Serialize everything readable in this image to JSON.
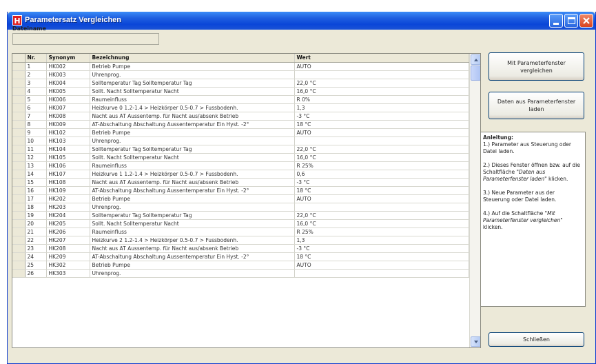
{
  "window": {
    "title": "Parametersatz Vergleichen",
    "icon_letter": "H"
  },
  "file": {
    "label": "Dateiname",
    "value": ""
  },
  "grid": {
    "columns": [
      "Nr.",
      "Synonym",
      "Bezeichnung",
      "Wert"
    ],
    "rows": [
      [
        "1",
        "HK002",
        "Betrieb Pumpe",
        "AUTO"
      ],
      [
        "2",
        "HK003",
        "Uhrenprog.",
        ""
      ],
      [
        "3",
        "HK004",
        "Solltemperatur Tag Solltemperatur Tag",
        "22,0 °C"
      ],
      [
        "4",
        "HK005",
        "Sollt. Nacht Solltemperatur Nacht",
        "16,0 °C"
      ],
      [
        "5",
        "HK006",
        "Raumeinfluss",
        "R  0%"
      ],
      [
        "6",
        "HK007",
        "Heizkurve 0 1.2-1.4 > Heizkörper 0.5-0.7 > Fussbodenh.",
        "1,3"
      ],
      [
        "7",
        "HK008",
        "Nacht aus AT Aussentemp. für Nacht aus/absenk Betrieb",
        "-3 °C"
      ],
      [
        "8",
        "HK009",
        "AT-Abschaltung Abschaltung Aussentemperatur Ein Hyst. -2°",
        "18 °C"
      ],
      [
        "9",
        "HK102",
        "Betrieb Pumpe",
        "AUTO"
      ],
      [
        "10",
        "HK103",
        "Uhrenprog.",
        ""
      ],
      [
        "11",
        "HK104",
        "Solltemperatur Tag Solltemperatur Tag",
        "22,0 °C"
      ],
      [
        "12",
        "HK105",
        "Sollt. Nacht Solltemperatur Nacht",
        "16,0 °C"
      ],
      [
        "13",
        "HK106",
        "Raumeinfluss",
        "R  25%"
      ],
      [
        "14",
        "HK107",
        "Heizkurve 1 1.2-1.4 > Heizkörper 0.5-0.7 > Fussbodenh.",
        "0,6"
      ],
      [
        "15",
        "HK108",
        "Nacht aus AT Aussentemp. für Nacht aus/absenk Betrieb",
        "-3 °C"
      ],
      [
        "16",
        "HK109",
        "AT-Abschaltung Abschaltung Aussentemperatur Ein Hyst. -2°",
        "18 °C"
      ],
      [
        "17",
        "HK202",
        "Betrieb Pumpe",
        "AUTO"
      ],
      [
        "18",
        "HK203",
        "Uhrenprog.",
        ""
      ],
      [
        "19",
        "HK204",
        "Solltemperatur Tag Solltemperatur Tag",
        "22,0 °C"
      ],
      [
        "20",
        "HK205",
        "Sollt. Nacht Solltemperatur Nacht",
        "16,0 °C"
      ],
      [
        "21",
        "HK206",
        "Raumeinfluss",
        "R  25%"
      ],
      [
        "22",
        "HK207",
        "Heizkurve 2 1.2-1.4 > Heizkörper 0.5-0.7 > Fussbodenh.",
        "1,3"
      ],
      [
        "23",
        "HK208",
        "Nacht aus AT Aussentemp. für Nacht aus/absenk Betrieb",
        "-3 °C"
      ],
      [
        "24",
        "HK209",
        "AT-Abschaltung Abschaltung Aussentemperatur Ein Hyst. -2°",
        "18 °C"
      ],
      [
        "25",
        "HK302",
        "Betrieb Pumpe",
        "AUTO"
      ],
      [
        "26",
        "HK303",
        "Uhrenprog.",
        ""
      ]
    ]
  },
  "buttons": {
    "compare": "Mit Parameterfenster vergleichen",
    "load": "Daten aus Parameterfenster laden",
    "close": "Schließen"
  },
  "instructions": {
    "heading": "Anleitung:",
    "step1": "1.) Parameter aus Steuerung oder Datei laden.",
    "step2_prefix": "2.) Dieses Fenster öffnen bzw. auf die Schaltfläche \"",
    "step2_em": "Daten aus Parameterfenster laden",
    "step2_suffix": "\" klicken.",
    "step3": "3.) Neue Parameter aus der Steuerung oder Datei laden.",
    "step4_prefix": "4.) Auf die Schaltfläche \"",
    "step4_em": "Mit Parameterfenster vergleichen",
    "step4_suffix": "\" klicken."
  }
}
